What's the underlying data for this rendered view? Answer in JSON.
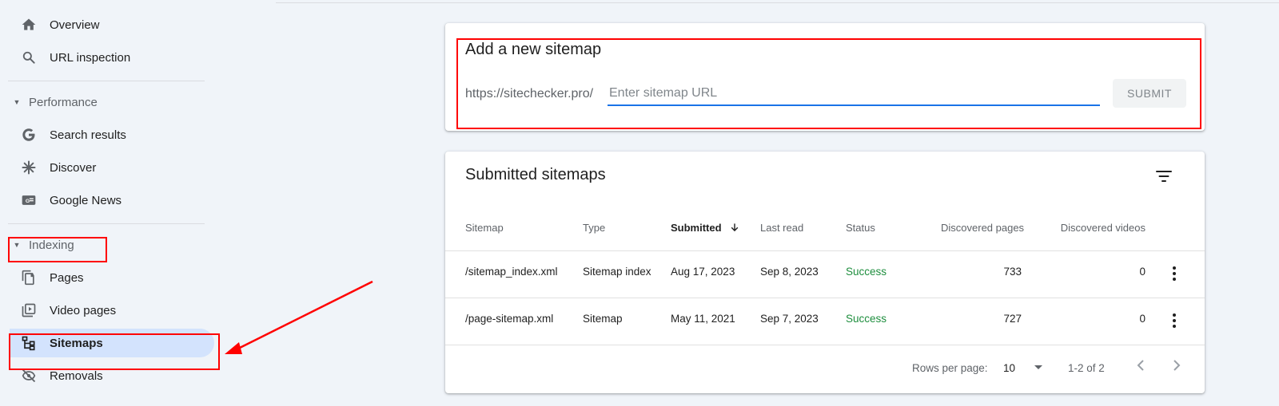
{
  "sidebar": {
    "items": [
      {
        "label": "Overview",
        "icon": "home-icon"
      },
      {
        "label": "URL inspection",
        "icon": "search-icon"
      }
    ],
    "performance": {
      "header": "Performance",
      "items": [
        {
          "label": "Search results",
          "icon": "google-g-icon"
        },
        {
          "label": "Discover",
          "icon": "asterisk-icon"
        },
        {
          "label": "Google News",
          "icon": "google-news-icon"
        }
      ]
    },
    "indexing": {
      "header": "Indexing",
      "items": [
        {
          "label": "Pages",
          "icon": "pages-icon"
        },
        {
          "label": "Video pages",
          "icon": "video-pages-icon"
        },
        {
          "label": "Sitemaps",
          "icon": "sitemap-icon",
          "active": true
        },
        {
          "label": "Removals",
          "icon": "eye-off-icon"
        }
      ]
    }
  },
  "add_sitemap": {
    "title": "Add a new sitemap",
    "prefix": "https://sitechecker.pro/",
    "placeholder": "Enter sitemap URL",
    "value": "",
    "submit_label": "SUBMIT"
  },
  "submitted": {
    "title": "Submitted sitemaps",
    "columns": [
      "Sitemap",
      "Type",
      "Submitted",
      "Last read",
      "Status",
      "Discovered pages",
      "Discovered videos"
    ],
    "sorted_column": "Submitted",
    "rows": [
      {
        "sitemap": "/sitemap_index.xml",
        "type": "Sitemap index",
        "submitted": "Aug 17, 2023",
        "last_read": "Sep 8, 2023",
        "status": "Success",
        "pages": "733",
        "videos": "0"
      },
      {
        "sitemap": "/page-sitemap.xml",
        "type": "Sitemap",
        "submitted": "May 11, 2021",
        "last_read": "Sep 7, 2023",
        "status": "Success",
        "pages": "727",
        "videos": "0"
      }
    ],
    "footer": {
      "rows_per_page_label": "Rows per page:",
      "rows_per_page_value": "10",
      "range": "1-2 of 2"
    }
  },
  "colors": {
    "accent": "#1a73e8",
    "success": "#1e8e3e",
    "active_bg": "#d3e3fd",
    "annotation": "#ff0000"
  }
}
